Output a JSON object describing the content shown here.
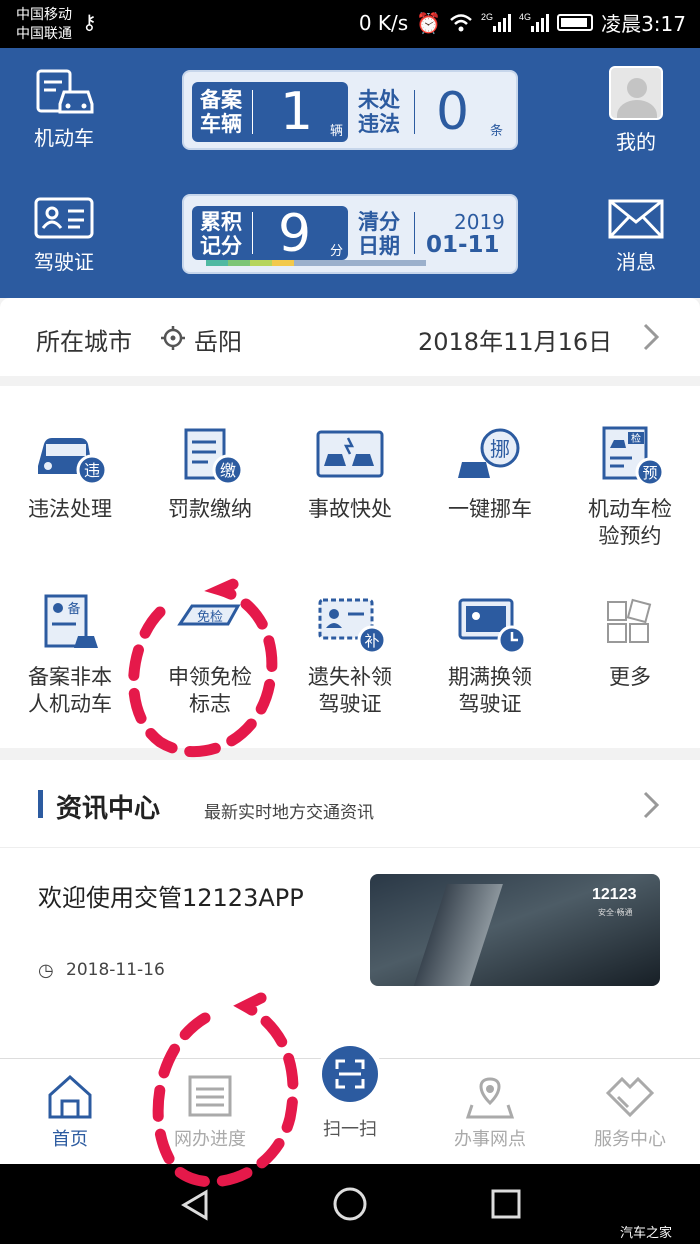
{
  "status_bar": {
    "carrier1": "中国移动",
    "carrier2": "中国联通",
    "speed": "0 K/s",
    "time": "凌晨3:17",
    "net1": "2G",
    "net2": "4G"
  },
  "header": {
    "vehicle_label": "机动车",
    "license_label": "驾驶证",
    "profile_label": "我的",
    "message_label": "消息",
    "registered": {
      "label1": "备案",
      "label2": "车辆",
      "value": "1",
      "unit": "辆"
    },
    "violations": {
      "label1": "未处",
      "label2": "违法",
      "value": "0",
      "unit": "条"
    },
    "points": {
      "label1": "累积",
      "label2": "记分",
      "value": "9",
      "unit": "分"
    },
    "clear_date": {
      "label1": "清分",
      "label2": "日期",
      "year": "2019",
      "date": "01-11"
    }
  },
  "city_bar": {
    "label": "所在城市",
    "city": "岳阳",
    "date": "2018年11月16日"
  },
  "services": [
    {
      "label": "违法处理",
      "badge": "违"
    },
    {
      "label": "罚款缴纳",
      "badge": "缴"
    },
    {
      "label": "事故快处"
    },
    {
      "label": "一键挪车",
      "badge": "挪"
    },
    {
      "label": "机动车检验预约",
      "badge": "预",
      "tag": "检"
    },
    {
      "label": "备案非本人机动车",
      "badge": "备"
    },
    {
      "label": "申领免检标志",
      "tag": "免检"
    },
    {
      "label": "遗失补领驾驶证",
      "badge": "补"
    },
    {
      "label": "期满换领驾驶证"
    },
    {
      "label": "更多"
    }
  ],
  "news": {
    "title": "资讯中心",
    "subtitle": "最新实时地方交通资讯",
    "item_title": "欢迎使用交管12123APP",
    "item_date": "2018-11-16",
    "thumb_brand": "12123",
    "thumb_slogan": "安全·畅通"
  },
  "tabs": [
    {
      "label": "首页",
      "active": true
    },
    {
      "label": "网办进度"
    },
    {
      "label": "扫一扫"
    },
    {
      "label": "办事网点"
    },
    {
      "label": "服务中心"
    }
  ],
  "watermark": "汽车之家",
  "colors": {
    "primary": "#2c5ba0",
    "annotation": "#e5194a"
  }
}
